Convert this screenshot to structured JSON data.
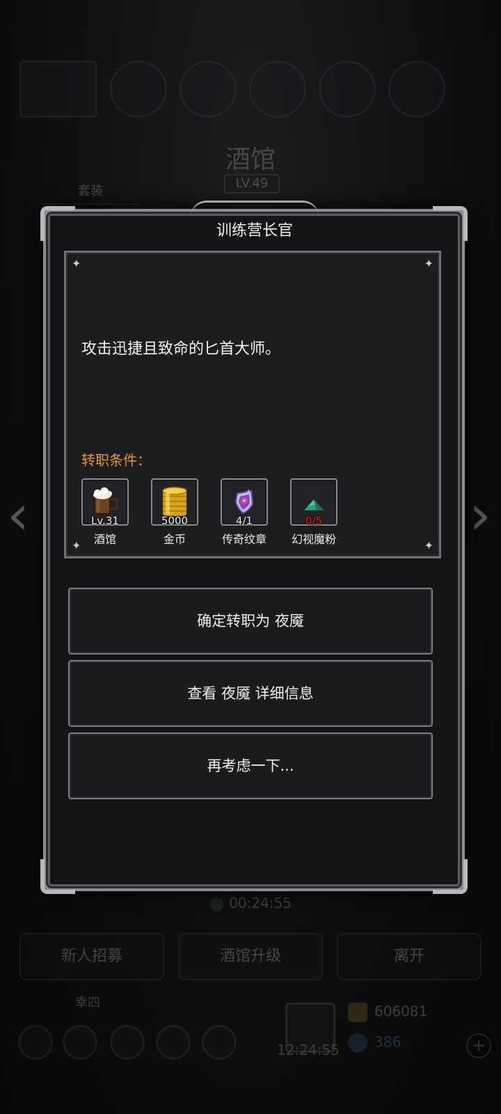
{
  "background": {
    "building_title": "酒馆",
    "building_level": "LV.49",
    "tab_label": "套装",
    "timer": "00:24:55",
    "buttons": [
      "新人招募",
      "酒馆升级",
      "离开"
    ],
    "player_name": "幸四",
    "chest_clock": "12:24:55",
    "gold": "606081",
    "gems": "386"
  },
  "dialog": {
    "title": "训练营长官",
    "description": "攻击迅捷且致命的匕首大师。",
    "requirements_label": "转职条件：",
    "requirements": [
      {
        "icon": "beer-mug-icon",
        "value": "Lv.31",
        "name": "酒馆",
        "met": true
      },
      {
        "icon": "gold-coins-icon",
        "value": "5000",
        "name": "金币",
        "met": true
      },
      {
        "icon": "legendary-emblem-icon",
        "value": "4/1",
        "name": "传奇纹章",
        "met": true
      },
      {
        "icon": "illusion-powder-icon",
        "value": "0/5",
        "name": "幻视魔粉",
        "met": false
      }
    ],
    "actions": {
      "confirm": "确定转职为 夜魇",
      "details": "查看 夜魇 详细信息",
      "cancel": "再考虑一下..."
    }
  },
  "colors": {
    "requirement_label": "#e39a2a",
    "unmet_value": "#e02020"
  }
}
